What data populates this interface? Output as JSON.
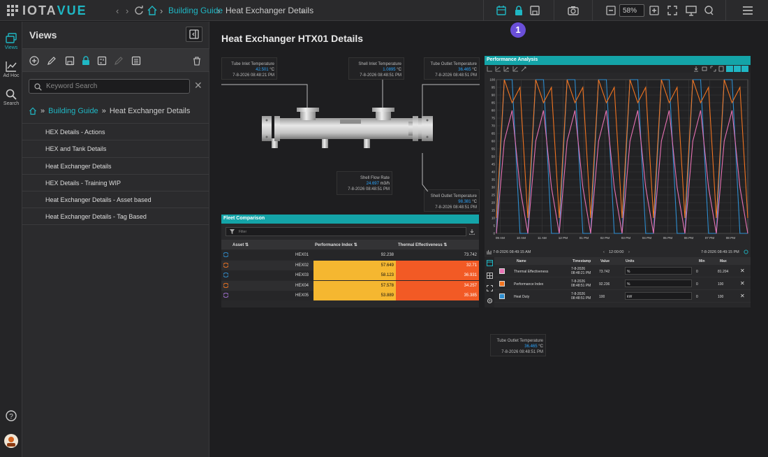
{
  "app": {
    "brand_a": "IOTA",
    "brand_b": "VUE"
  },
  "topbar": {
    "crumb_root": "Building Guide",
    "crumb_current": "Heat Exchanger Details",
    "zoom": "58%",
    "badge": "1"
  },
  "rail": {
    "views": "Views",
    "adhoc": "Ad Hoc",
    "search": "Search"
  },
  "panel": {
    "title": "Views",
    "search_placeholder": "Keyword Search",
    "crumb_root": "Building Guide",
    "crumb_current": "Heat Exchanger Details",
    "items": [
      "HEX Details - Actions",
      "HEX and Tank Details",
      "Heat Exchanger Details",
      "HEX Details - Training WIP",
      "Heat Exchanger Details - Asset based",
      "Heat Exchanger Details - Tag Based"
    ]
  },
  "page": {
    "title": "Heat Exchanger HTX01 Details"
  },
  "tags": [
    {
      "name": "Tube Inlet Temperature",
      "value": "42.501",
      "unit": "°C",
      "time": "7-8-2026 08:48:21 PM"
    },
    {
      "name": "Shell Inlet Temperature",
      "value": "1.0895",
      "unit": "°C",
      "time": "7-8-2026 08:48:51 PM"
    },
    {
      "name": "Tube Outlet Temperature",
      "value": "36.465",
      "unit": "°C",
      "time": "7-8-2026 08:48:51 PM"
    },
    {
      "name": "Shell Flow Rate",
      "value": "24.697",
      "unit": "m3/h",
      "time": "7-8-2026 08:48:51 PM"
    },
    {
      "name": "Shell Outlet Temperature",
      "value": "98.381",
      "unit": "°C",
      "time": "7-8-2026 08:48:51 PM"
    },
    {
      "name": "Tube Outlet Temperature",
      "value": "36.465",
      "unit": "°C",
      "time": "7-8-2026 08:48:51 PM"
    }
  ],
  "fleet": {
    "title": "Fleet Comparison",
    "filter_placeholder": "Filter",
    "columns": [
      "Asset",
      "Performance Index",
      "Thermal Effectiveness"
    ],
    "rows": [
      {
        "asset": "HEX01",
        "pi": "92.238",
        "te": "73.742",
        "pi_color": "",
        "te_color": ""
      },
      {
        "asset": "HEX02",
        "pi": "57.649",
        "te": "32.71",
        "pi_color": "#f5b730",
        "te_color": "#f25a25"
      },
      {
        "asset": "HEX03",
        "pi": "58.123",
        "te": "36.931",
        "pi_color": "#f5b730",
        "te_color": "#f25a25"
      },
      {
        "asset": "HEX04",
        "pi": "57.578",
        "te": "34.257",
        "pi_color": "#f5b730",
        "te_color": "#f25a25"
      },
      {
        "asset": "HEX05",
        "pi": "53.889",
        "te": "35.385",
        "pi_color": "#f5b730",
        "te_color": "#f25a25"
      }
    ]
  },
  "perf": {
    "title": "Performance Analysis",
    "start": "7-8-2026 08:49:15 AM",
    "span": "12:00:00",
    "end": "7-8-2026 08:49:15 PM",
    "legend_headers": [
      "Name",
      "Timestamp",
      "Value",
      "Units",
      "Min",
      "Max"
    ],
    "legend": [
      {
        "name": "Thermal Effectiveness",
        "ts": "7-8-2026 08:48:21 PM",
        "value": "73.742",
        "units": "%",
        "min": "0",
        "max": "81.204",
        "color": "#e872b4"
      },
      {
        "name": "Performance Index",
        "ts": "7-8-2026 08:48:51 PM",
        "value": "92.236",
        "units": "%",
        "min": "0",
        "max": "100",
        "color": "#f27420"
      },
      {
        "name": "Heat Duty",
        "ts": "7-8-2026 08:48:51 PM",
        "value": "100",
        "units": "kW",
        "min": "0",
        "max": "100",
        "color": "#2e8ed0"
      }
    ]
  },
  "chart_data": {
    "type": "line",
    "ylim": [
      0,
      100
    ],
    "yticks": [
      0,
      5,
      10,
      15,
      20,
      25,
      30,
      35,
      40,
      45,
      50,
      55,
      60,
      65,
      70,
      75,
      80,
      85,
      90,
      95,
      100
    ],
    "xticks": [
      "09 AM",
      "10 AM",
      "11 AM",
      "12 PM",
      "01 PM",
      "02 PM",
      "03 PM",
      "04 PM",
      "05 PM",
      "06 PM",
      "07 PM",
      "08 PM"
    ],
    "x_start_hour": 8.82,
    "x_end_hour": 20.82,
    "series": [
      {
        "name": "Heat Duty",
        "color": "#2e8ed0",
        "values": [
          0,
          100,
          100,
          0,
          0,
          100,
          100,
          0,
          0,
          100,
          100,
          0
        ]
      },
      {
        "name": "Performance Index",
        "color": "#f27420",
        "values": [
          10,
          100,
          85,
          95,
          10,
          100,
          85,
          95,
          10,
          100,
          85,
          95
        ]
      },
      {
        "name": "Thermal Effectiveness",
        "color": "#e872b4",
        "values": [
          0,
          60,
          80,
          30,
          0,
          60,
          80,
          30,
          0,
          60,
          80,
          30
        ]
      }
    ]
  }
}
